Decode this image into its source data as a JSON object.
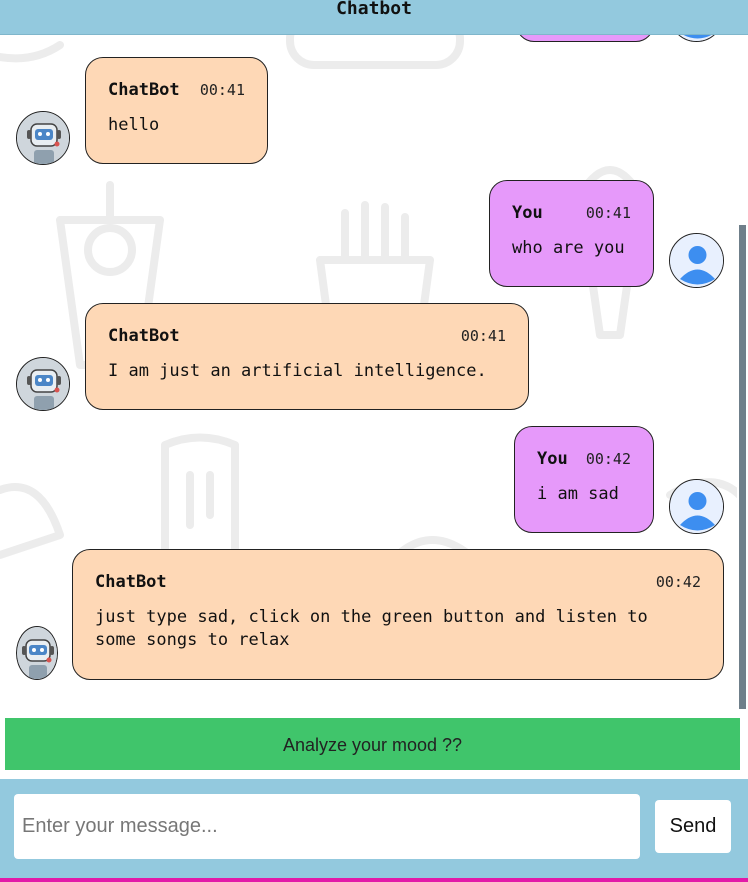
{
  "header": {
    "title": "Chatbot"
  },
  "messages": [
    {
      "sender": "ChatBot",
      "time": "00:41",
      "text": "hello",
      "role": "bot"
    },
    {
      "sender": "You",
      "time": "00:41",
      "text": "who are you",
      "role": "user"
    },
    {
      "sender": "ChatBot",
      "time": "00:41",
      "text": "I am just an artificial intelligence.",
      "role": "bot"
    },
    {
      "sender": "You",
      "time": "00:42",
      "text": "i am sad",
      "role": "user"
    },
    {
      "sender": "ChatBot",
      "time": "00:42",
      "text": "just type sad, click on the green button and listen to\nsome songs to relax",
      "role": "bot"
    }
  ],
  "mood_button": {
    "label": "Analyze your mood ??"
  },
  "composer": {
    "placeholder": "Enter your message...",
    "value": "",
    "send_label": "Send"
  },
  "colors": {
    "header_bg": "#93c9de",
    "bot_bubble": "#fed8b6",
    "user_bubble": "#e699fa",
    "mood_button": "#40c56b",
    "accent_line": "#e21aa8"
  },
  "icons": {
    "bot_avatar": "robot-avatar-icon",
    "user_avatar": "user-avatar-icon"
  }
}
